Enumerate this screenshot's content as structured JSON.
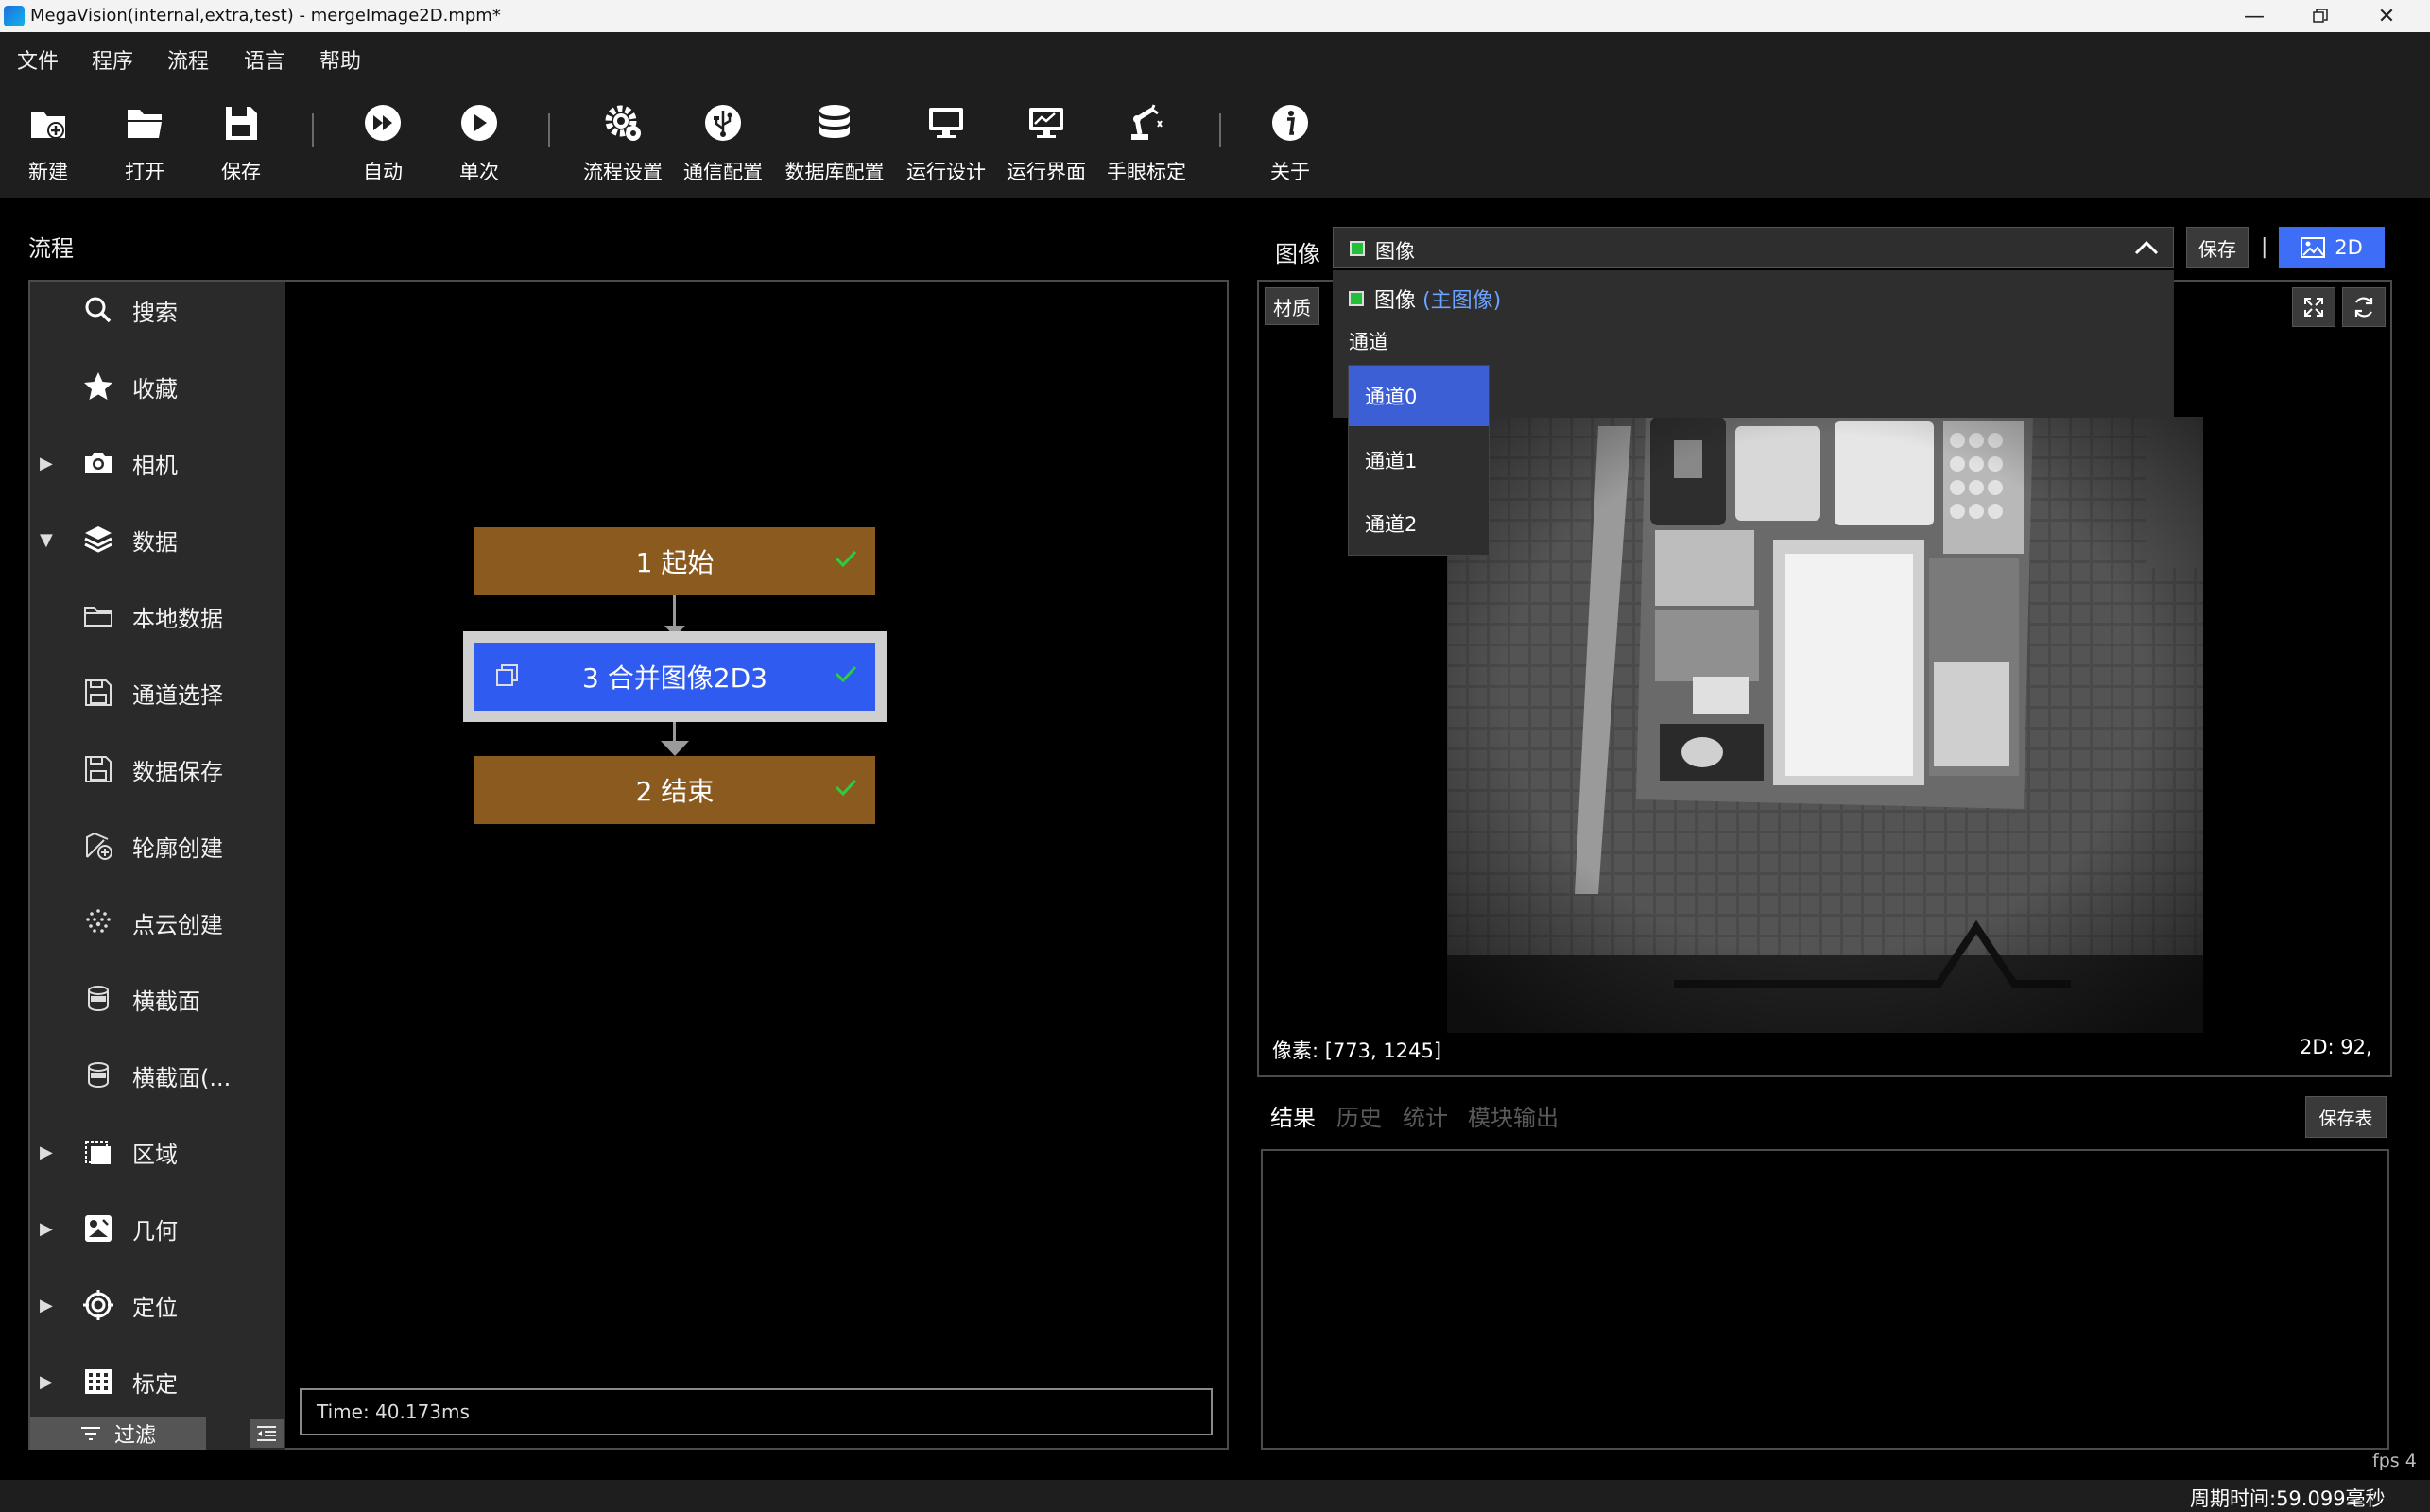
{
  "window": {
    "title": "MegaVision(internal,extra,test) - mergeImage2D.mpm*",
    "controls": [
      "minimize",
      "restore",
      "close"
    ]
  },
  "menu": [
    "文件",
    "程序",
    "流程",
    "语言",
    "帮助"
  ],
  "toolbar": {
    "new": "新建",
    "open": "打开",
    "save": "保存",
    "auto": "自动",
    "single": "单次",
    "flow_settings": "流程设置",
    "comm_config": "通信配置",
    "db_config": "数据库配置",
    "run_design": "运行设计",
    "run_ui": "运行界面",
    "hand_eye": "手眼标定",
    "about": "关于"
  },
  "flow_panel": {
    "title": "流程",
    "sidebar": [
      {
        "label": "搜索",
        "icon": "search-icon",
        "arrow": ""
      },
      {
        "label": "收藏",
        "icon": "star-icon",
        "arrow": ""
      },
      {
        "label": "相机",
        "icon": "camera-icon",
        "arrow": "▶"
      },
      {
        "label": "数据",
        "icon": "layers-icon",
        "arrow": "▼"
      },
      {
        "label": "本地数据",
        "icon": "folder-icon",
        "arrow": ""
      },
      {
        "label": "通道选择",
        "icon": "save-icon",
        "arrow": ""
      },
      {
        "label": "数据保存",
        "icon": "save-icon",
        "arrow": ""
      },
      {
        "label": "轮廓创建",
        "icon": "contour-icon",
        "arrow": ""
      },
      {
        "label": "点云创建",
        "icon": "pointcloud-icon",
        "arrow": ""
      },
      {
        "label": "横截面",
        "icon": "cross-section-icon",
        "arrow": ""
      },
      {
        "label": "横截面(...",
        "icon": "cross-section-icon",
        "arrow": ""
      },
      {
        "label": "区域",
        "icon": "region-icon",
        "arrow": "▶"
      },
      {
        "label": "几何",
        "icon": "geometry-icon",
        "arrow": "▶"
      },
      {
        "label": "定位",
        "icon": "locate-icon",
        "arrow": "▶"
      },
      {
        "label": "标定",
        "icon": "calibration-grid-icon",
        "arrow": "▶"
      }
    ],
    "filter_label": "过滤",
    "nodes": [
      {
        "label": "1 起始",
        "status": "ok"
      },
      {
        "label": "3 合并图像2D3",
        "status": "ok",
        "selected": true
      },
      {
        "label": "2 结束",
        "status": "ok"
      }
    ],
    "time": "Time: 40.173ms"
  },
  "image_panel": {
    "label": "图像",
    "selected": "图像",
    "save_button": "保存",
    "separator": "|",
    "mode_button": "2D",
    "dropdown_item": "图像",
    "dropdown_item_tag": "(主图像)",
    "channel_heading": "通道",
    "channels": [
      "通道0",
      "通道1",
      "通道2"
    ],
    "selected_channel": "通道0",
    "material_button": "材质",
    "pixel_readout": "像素: [773, 1245]",
    "value_readout": "2D: 92,"
  },
  "results": {
    "tabs": [
      "结果",
      "历史",
      "统计",
      "模块输出"
    ],
    "active_tab": "结果",
    "save_table": "保存表"
  },
  "status": {
    "fps": "fps 4",
    "cycle_time": "周期时间:59.099毫秒"
  },
  "colors": {
    "node_brown": "#8a5a1e",
    "node_selected_blue": "#2f5bf0",
    "accent_blue": "#3d6ef5",
    "check_green": "#2ecc40",
    "main_image_tag": "#6ba3ff"
  }
}
